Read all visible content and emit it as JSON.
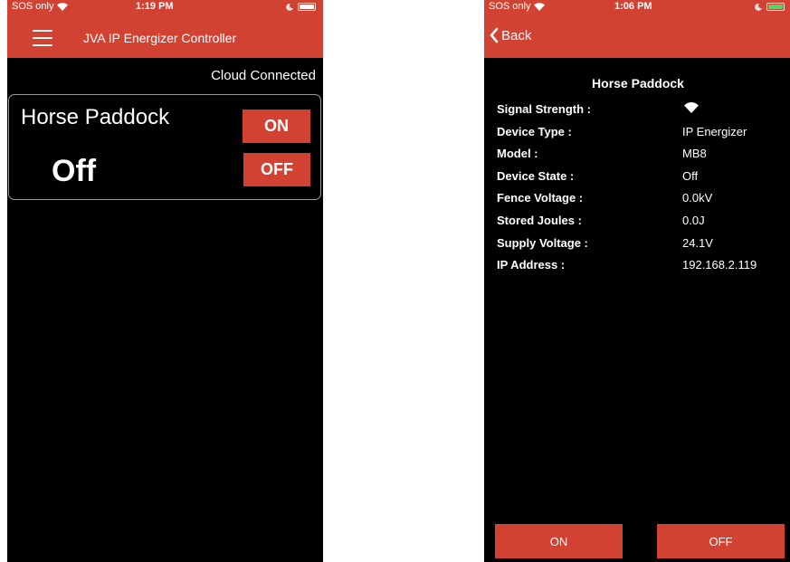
{
  "left_screen": {
    "status": {
      "carrier": "SOS only",
      "time": "1:19 PM"
    },
    "app_title": "JVA IP Energizer Controller",
    "connection_status": "Cloud Connected",
    "device": {
      "name": "Horse Paddock",
      "state": "Off",
      "on_label": "ON",
      "off_label": "OFF"
    }
  },
  "right_screen": {
    "status": {
      "carrier": "SOS only",
      "time": "1:06 PM"
    },
    "back_label": "Back",
    "device_title": "Horse Paddock",
    "details": [
      {
        "label": "Signal Strength :",
        "value": "",
        "icon": "wifi-signal-icon"
      },
      {
        "label": "Device Type :",
        "value": "IP Energizer"
      },
      {
        "label": "Model :",
        "value": "MB8"
      },
      {
        "label": "Device State :",
        "value": "Off"
      },
      {
        "label": "Fence Voltage :",
        "value": "0.0kV"
      },
      {
        "label": "Stored Joules :",
        "value": "0.0J"
      },
      {
        "label": "Supply Voltage :",
        "value": "24.1V"
      },
      {
        "label": "IP Address :",
        "value": "192.168.2.119"
      }
    ],
    "on_label": "ON",
    "off_label": "OFF"
  },
  "colors": {
    "accent": "#d24233",
    "background": "#000000",
    "text": "#ffffff",
    "battery_charging": "#4cd964"
  }
}
